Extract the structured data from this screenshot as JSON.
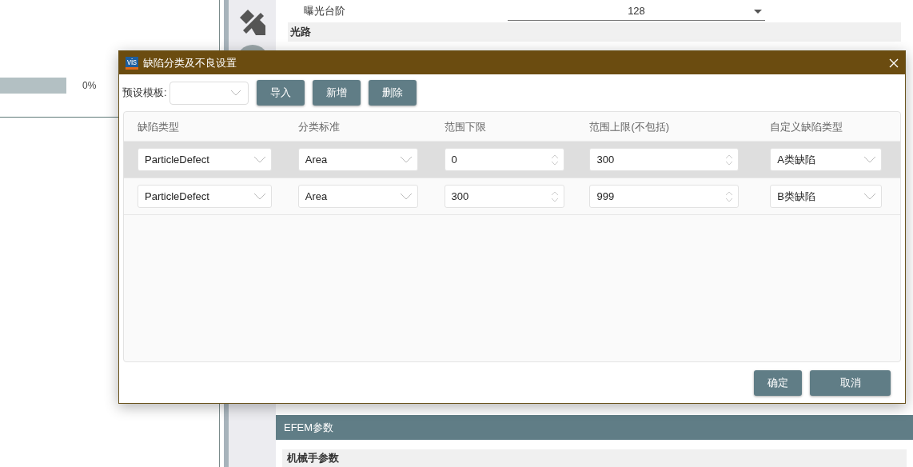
{
  "background": {
    "progress": {
      "level": 0,
      "reading": "0%"
    },
    "settings": {
      "exposure_label": "曝光台阶",
      "exposure_value": "128",
      "section": "光路"
    },
    "efem_header": "EFEM参数",
    "efem_subsection": "机械手参数"
  },
  "dialog": {
    "title": "缺陷分类及不良设置",
    "app_badge": "vis",
    "template_label": "预设模板:",
    "toolbar_buttons": [
      "导入",
      "新增",
      "删除"
    ],
    "table": {
      "columns": [
        "缺陷类型",
        "分类标准",
        "范围下限",
        "范围上限(不包括)",
        "自定义缺陷类型"
      ],
      "rows": [
        {
          "selected": true,
          "cells": [
            {
              "kind": "combo",
              "value": "ParticleDefect"
            },
            {
              "kind": "combo",
              "value": "Area"
            },
            {
              "kind": "spin",
              "value": "0"
            },
            {
              "kind": "spin",
              "value": "300"
            },
            {
              "kind": "combo",
              "value": "A类缺陷"
            }
          ]
        },
        {
          "selected": false,
          "cells": [
            {
              "kind": "combo",
              "value": "ParticleDefect"
            },
            {
              "kind": "combo",
              "value": "Area"
            },
            {
              "kind": "spin",
              "value": "300"
            },
            {
              "kind": "spin",
              "value": "999"
            },
            {
              "kind": "combo",
              "value": "B类缺陷"
            }
          ]
        }
      ]
    },
    "footer_buttons": [
      "确定",
      "取消"
    ]
  }
}
